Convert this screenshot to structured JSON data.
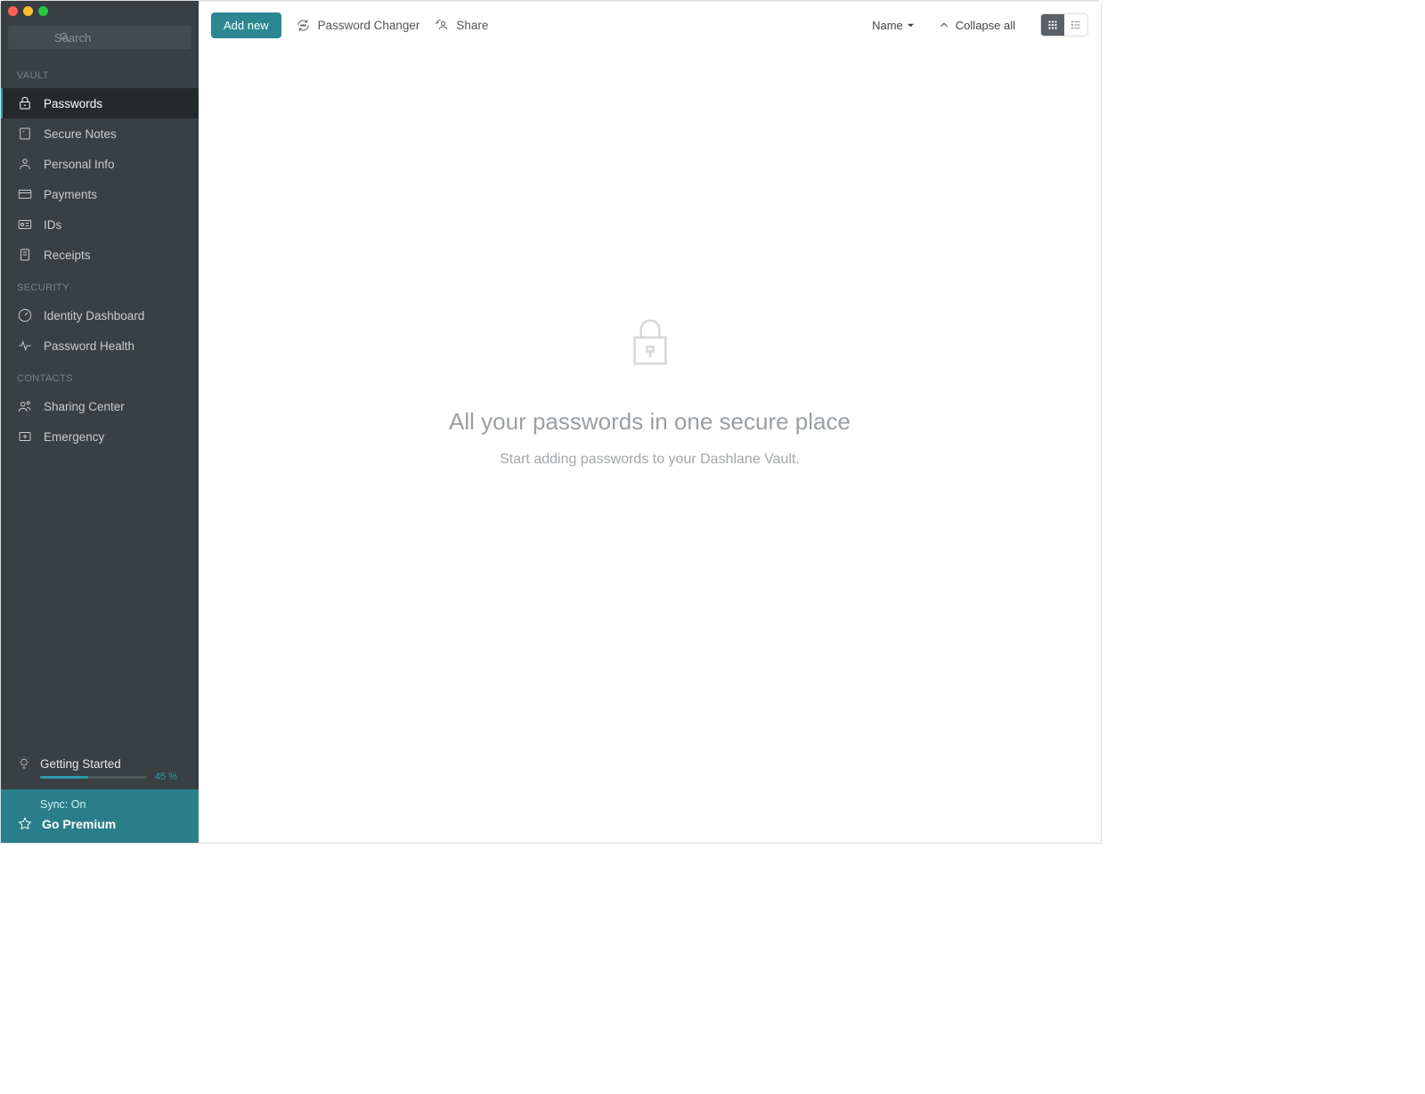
{
  "search": {
    "placeholder": "Search"
  },
  "sidebar": {
    "section_vault": "VAULT",
    "section_security": "SECURITY",
    "section_contacts": "CONTACTS",
    "items": {
      "passwords": "Passwords",
      "secure_notes": "Secure Notes",
      "personal_info": "Personal Info",
      "payments": "Payments",
      "ids": "IDs",
      "receipts": "Receipts",
      "identity_dashboard": "Identity Dashboard",
      "password_health": "Password Health",
      "sharing_center": "Sharing Center",
      "emergency": "Emergency"
    }
  },
  "getting_started": {
    "label": "Getting Started",
    "percent_text": "45 %",
    "percent_value": 45
  },
  "footer": {
    "sync": "Sync: On",
    "premium": "Go Premium"
  },
  "toolbar": {
    "add_new": "Add new",
    "password_changer": "Password Changer",
    "share": "Share",
    "sort_label": "Name",
    "collapse": "Collapse all"
  },
  "empty": {
    "title": "All your passwords in one secure place",
    "subtitle": "Start adding passwords to your Dashlane Vault."
  }
}
